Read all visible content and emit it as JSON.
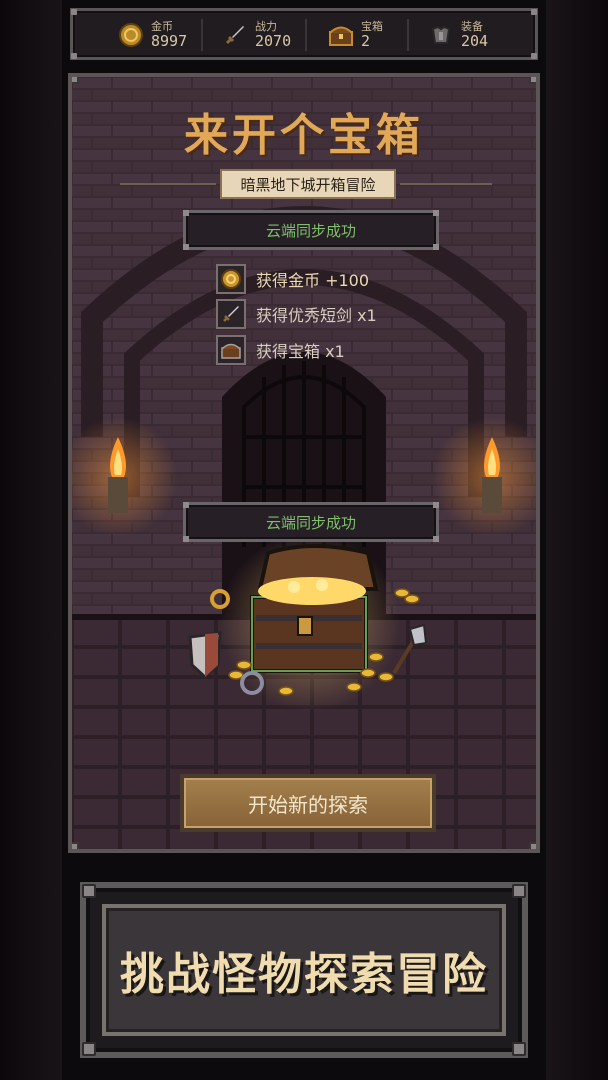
{
  "stats": {
    "gold": {
      "label": "金币",
      "value": "8997",
      "icon": "gold-coin-icon"
    },
    "power": {
      "label": "战力",
      "value": "2070",
      "icon": "sword-icon"
    },
    "chests": {
      "label": "宝箱",
      "value": "2",
      "icon": "treasure-chest-icon"
    },
    "equipment": {
      "label": "装备",
      "value": "204",
      "icon": "armor-icon"
    }
  },
  "game": {
    "title": "来开个宝箱",
    "subtitle": "暗黑地下城开箱冒险",
    "toast_top": "云端同步成功",
    "rewards": [
      {
        "text": "获得金币 +100",
        "icon": "gold-coin-icon"
      },
      {
        "text": "获得优秀短剑 x1",
        "icon": "short-sword-icon"
      },
      {
        "text": "获得宝箱 x1",
        "icon": "treasure-chest-icon"
      }
    ],
    "toast_mid": "云端同步成功",
    "start_button": "开始新的探索"
  },
  "banner": {
    "text": "挑战怪物探索冒险"
  },
  "colors": {
    "accent": "#e1a858",
    "success": "#7cc06a",
    "button": "#987044"
  }
}
